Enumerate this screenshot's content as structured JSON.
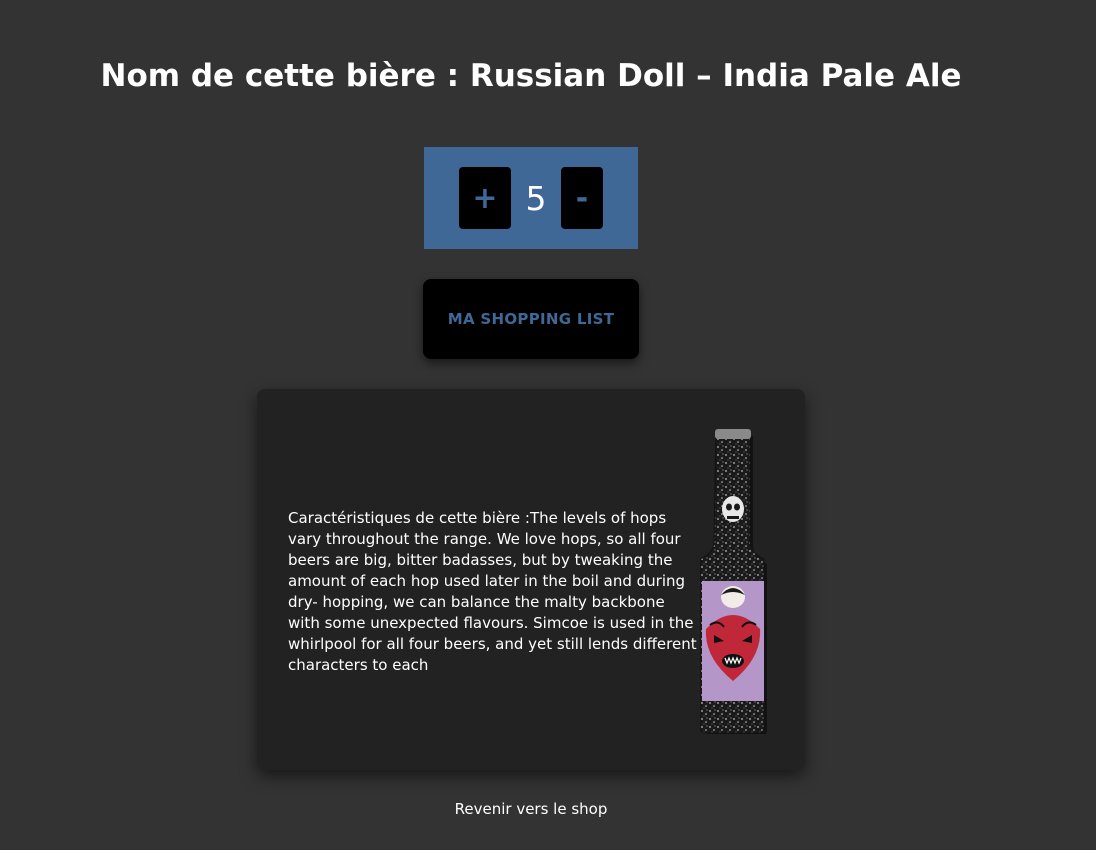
{
  "page": {
    "title": "Nom de cette bière : Russian Doll – India Pale Ale"
  },
  "quantity": {
    "plus_label": "+",
    "value": "5",
    "minus_label": "-"
  },
  "shopping_button": {
    "label": "MA SHOPPING LIST"
  },
  "card": {
    "description": "Caractéristiques de cette bière :The levels of hops vary throughout the range. We love hops, so all four beers are big, bitter badasses, but by tweaking the amount of each hop used later in the boil and during dry- hopping, we can balance the malty backbone with some unexpected flavours. Simcoe is used in the whirlpool for all four beers, and yet still lends different characters to each",
    "image_icon": "beer-bottle-image"
  },
  "footer": {
    "back_link": "Revenir vers le shop"
  },
  "colors": {
    "background": "#333333",
    "accent": "#3f6896",
    "card": "#222222",
    "button": "#000000"
  }
}
